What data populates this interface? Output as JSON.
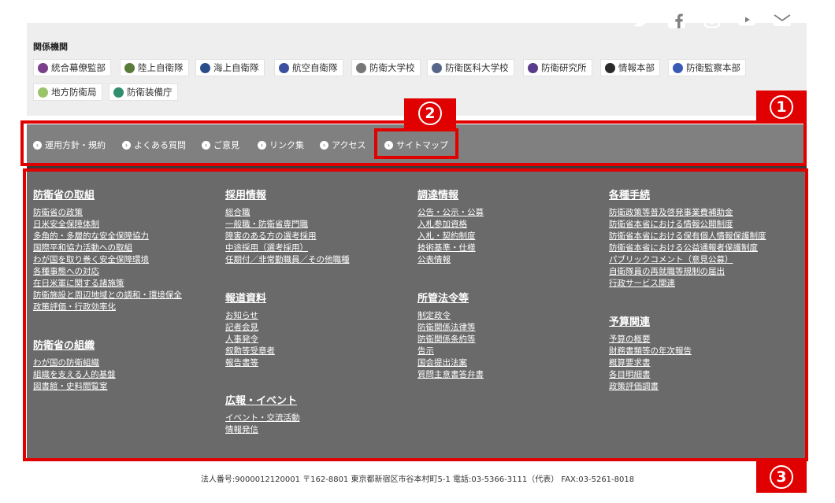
{
  "related": {
    "title": "関係機関",
    "agencies": [
      {
        "label": "統合幕僚監部",
        "icon": "joint-staff-emblem-icon",
        "color": "#7a3f8a"
      },
      {
        "label": "陸上自衛隊",
        "icon": "gsdf-emblem-icon",
        "color": "#5a7a3a"
      },
      {
        "label": "海上自衛隊",
        "icon": "msdf-emblem-icon",
        "color": "#2a4d8a"
      },
      {
        "label": "航空自衛隊",
        "icon": "asdf-emblem-icon",
        "color": "#3d4fa0"
      },
      {
        "label": "防衛大学校",
        "icon": "nda-emblem-icon",
        "color": "#777777"
      },
      {
        "label": "防衛医科大学校",
        "icon": "ndmc-emblem-icon",
        "color": "#556688"
      },
      {
        "label": "防衛研究所",
        "icon": "nids-logo-icon",
        "color": "#5b3c8c"
      },
      {
        "label": "情報本部",
        "icon": "dih-emblem-icon",
        "color": "#2a2a2a"
      },
      {
        "label": "防衛監察本部",
        "icon": "iggo-logo-icon",
        "color": "#3a5bb5"
      },
      {
        "label": "地方防衛局",
        "icon": "regional-bureau-icon",
        "color": "#9bc46a"
      },
      {
        "label": "防衛装備庁",
        "icon": "atla-globe-icon",
        "color": "#2f8f6f"
      }
    ]
  },
  "nav": {
    "links": [
      "運用方針・規約",
      "よくある質問",
      "ご意見",
      "リンク集",
      "アクセス",
      "サイトマップ"
    ],
    "social": [
      "twitter-icon",
      "facebook-icon",
      "instagram-icon",
      "youtube-icon",
      "mail-icon"
    ]
  },
  "sitemap": {
    "col1": {
      "sections": [
        {
          "title": "防衛省の取組",
          "links": [
            "防衛省の政策",
            "日米安全保障体制",
            "多角的・多層的な安全保障協力",
            "国際平和協力活動への取組",
            "わが国を取り巻く安全保障環境",
            "各種事態への対応",
            "在日米軍に関する諸施策",
            "防衛施設と周辺地域との調和・環境保全",
            "政策評価・行政効率化"
          ]
        },
        {
          "title": "防衛省の組織",
          "links": [
            "わが国の防衛組織",
            "組織を支える人的基盤",
            "図書館・史料閲覧室"
          ]
        }
      ]
    },
    "col2": {
      "sections": [
        {
          "title": "採用情報",
          "links": [
            "総合職",
            "一般職・防衛省専門職",
            "障害のある方の選考採用",
            "中途採用（選考採用）",
            "任期付／非常勤職員／その他職種"
          ]
        },
        {
          "title": "報道資料",
          "links": [
            "お知らせ",
            "記者会見",
            "人事発令",
            "叙勲等受章者",
            "報告書等"
          ]
        },
        {
          "title": "広報・イベント",
          "links": [
            "イベント・交流活動",
            "情報発信"
          ]
        }
      ]
    },
    "col3": {
      "sections": [
        {
          "title": "調達情報",
          "links": [
            "公告・公示・公募",
            "入札参加資格",
            "入札・契約制度",
            "技術基準・仕様",
            "公表情報"
          ]
        },
        {
          "title": "所管法令等",
          "links": [
            "制定政令",
            "防衛関係法律等",
            "防衛関係条約等",
            "告示",
            "国会提出法案",
            "質問主意書答弁書"
          ]
        }
      ]
    },
    "col4": {
      "sections": [
        {
          "title": "各種手続",
          "links": [
            "防衛政策等普及啓発事業費補助金",
            "防衛省本省における情報公開制度",
            "防衛省本省における保有個人情報保護制度",
            "防衛省本省における公益通報者保護制度",
            "パブリックコメント（意見公募）",
            "自衛隊員の再就職等規制の届出",
            "行政サービス関連"
          ]
        },
        {
          "title": "予算関連",
          "links": [
            "予算の概要",
            "財務書類等の年次報告",
            "概算要求書",
            "各目明細書",
            "政策評価調書"
          ]
        }
      ]
    }
  },
  "annotations": {
    "badge1": "1",
    "badge2": "2",
    "badge3": "3"
  },
  "footer": {
    "corporate_info": "法人番号:9000012120001 〒162-8801 東京都新宿区市谷本村町5-1 電話:03-5366-3111（代表） FAX:03-5261-8018"
  },
  "colors": {
    "annotation_red": "#e00000",
    "nav_gray": "#808080",
    "sitemap_gray": "#6a6a6a"
  }
}
